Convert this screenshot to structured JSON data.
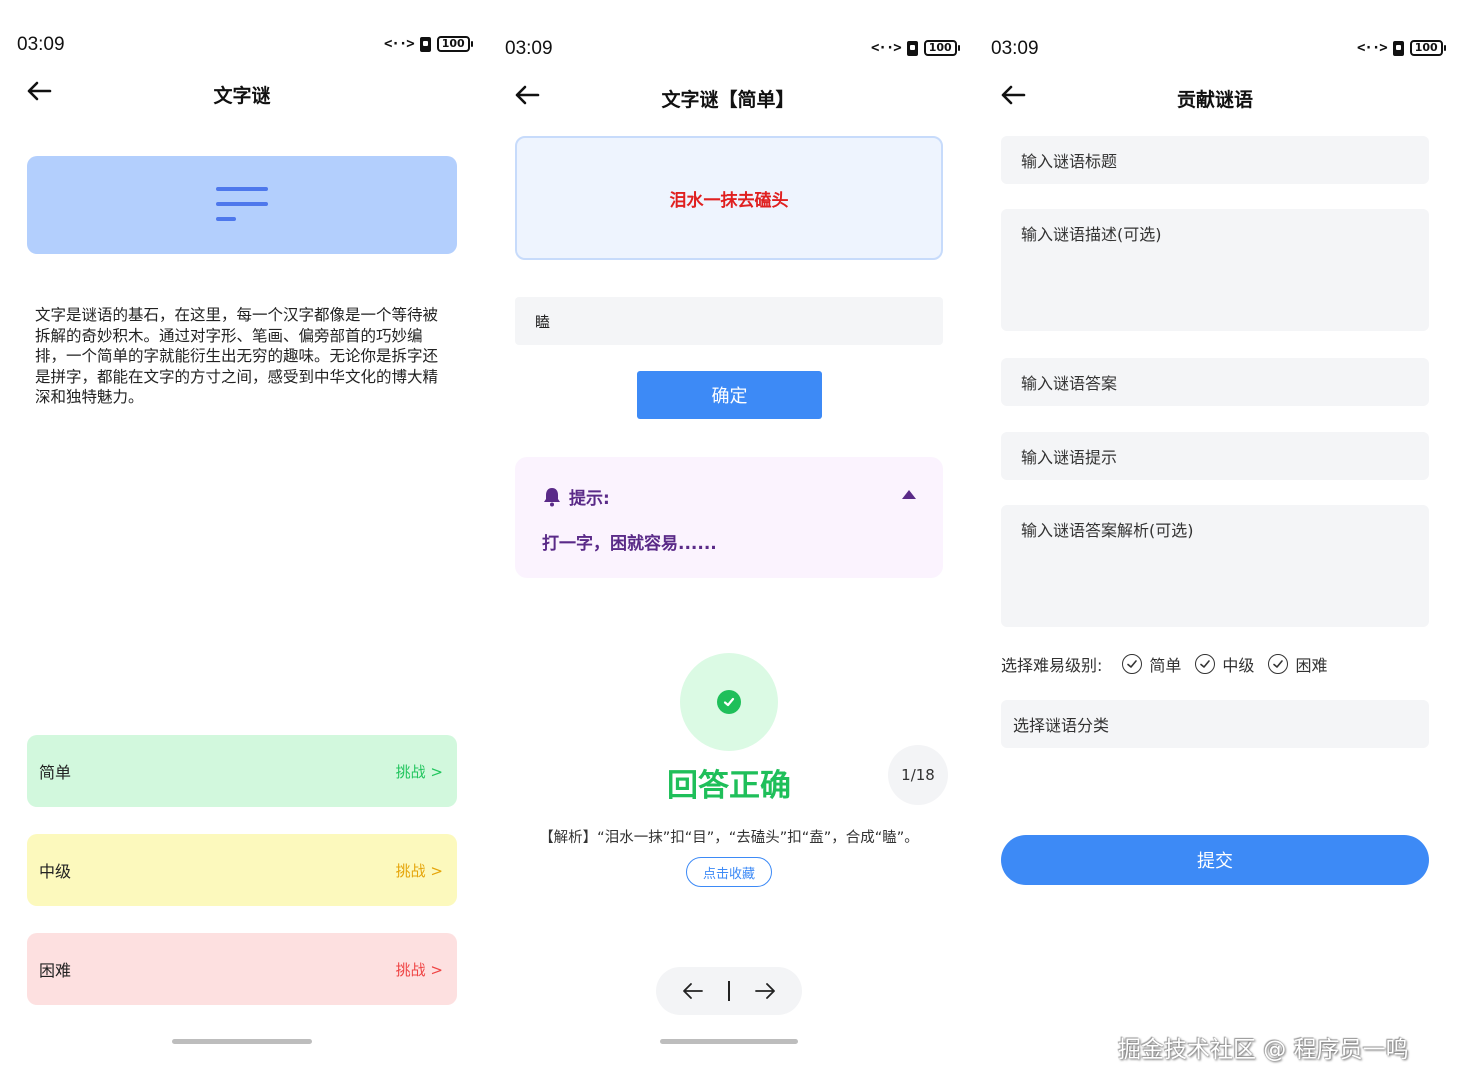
{
  "status_bar": {
    "time": "03:09",
    "signal": "<··>",
    "battery": "100"
  },
  "screen1": {
    "title": "文字谜",
    "description": "文字是谜语的基石，在这里，每一个汉字都像是一个等待被拆解的奇妙积木。通过对字形、笔画、偏旁部首的巧妙编排，一个简单的字就能衍生出无穷的趣味。无论你是拆字还是拼字，都能在文字的方寸之间，感受到中华文化的博大精深和独特魅力。",
    "levels": [
      {
        "name": "简单",
        "action": "挑战 >",
        "color": "#22c55e"
      },
      {
        "name": "中级",
        "action": "挑战 >",
        "color": "#e5a50a"
      },
      {
        "name": "困难",
        "action": "挑战 >",
        "color": "#ef4444"
      }
    ]
  },
  "screen2": {
    "title": "文字谜【简单】",
    "riddle": "泪水一抹去磕头",
    "answer_value": "瞌",
    "confirm_label": "确定",
    "hint_title": "提示:",
    "hint_text": "打一字，困就容易......",
    "result_text": "回答正确",
    "counter": "1/18",
    "analysis": "【解析】“泪水一抹”扣“目”，“去磕头”扣“盍”，合成“瞌”。",
    "favorite_label": "点击收藏"
  },
  "screen3": {
    "title": "贡献谜语",
    "fields": {
      "title_placeholder": "输入谜语标题",
      "desc_placeholder": "输入谜语描述(可选)",
      "answer_placeholder": "输入谜语答案",
      "hint_placeholder": "输入谜语提示",
      "analysis_placeholder": "输入谜语答案解析(可选)"
    },
    "difficulty_label": "选择难易级别:",
    "difficulty_options": [
      "简单",
      "中级",
      "困难"
    ],
    "category_label": "选择谜语分类",
    "submit_label": "提交"
  },
  "watermark": "掘金技术社区 @ 程序员一鸣",
  "colors": {
    "accent": "#3d8af6",
    "success": "#1fbf5a",
    "riddle_red": "#e02020",
    "hint_purple": "#5a2a88"
  }
}
